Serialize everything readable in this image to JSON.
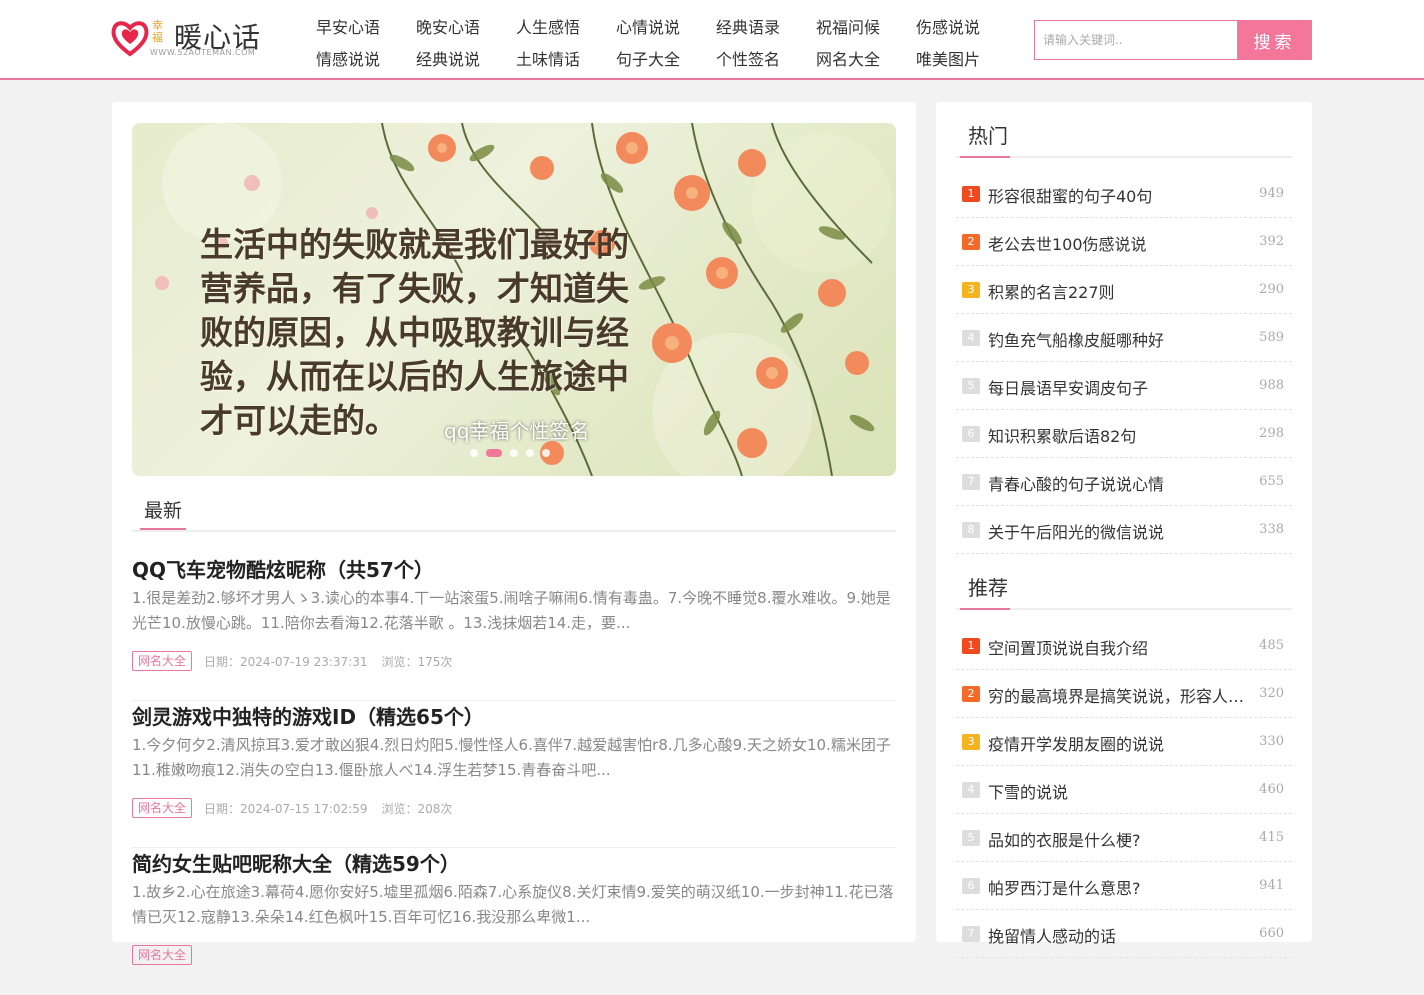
{
  "header": {
    "logo": {
      "text": "暖心话",
      "sub": "幸福",
      "url": "WWW.52AOTEMAN.COM"
    },
    "nav": [
      [
        "早安心语",
        "晚安心语",
        "人生感悟",
        "心情说说",
        "经典语录",
        "祝福问候",
        "伤感说说"
      ],
      [
        "情感说说",
        "经典说说",
        "土味情话",
        "句子大全",
        "个性签名",
        "网名大全",
        "唯美图片"
      ]
    ],
    "search": {
      "placeholder": "请输入关键词..",
      "button": "搜索"
    }
  },
  "banner": {
    "text": "生活中的失败就是我们最好的营养品，有了失败，才知道失败的原因，从中吸取教训与经验，从而在以后的人生旅途中才可以走的。",
    "caption": "qq幸福个性签名",
    "dots": 5,
    "active_dot": 2
  },
  "latest": {
    "title": "最新",
    "articles": [
      {
        "title": "QQ飞车宠物酷炫昵称（共57个）",
        "excerpt": "1.很是差劲2.够坏才男人ゝ3.读心的本事4.丅一站滚蛋5.闹啥子嘛闹6.情有毒蛊。7.今晚不睡觉8.覆水难收。9.她是光芒10.放慢心跳。11.陪你去看海12.花落半歌 。13.浅抹烟若14.走，要...",
        "tag": "网名大全",
        "date": "日期：2024-07-19 23:37:31",
        "views": "浏览：175次"
      },
      {
        "title": "剑灵游戏中独特的游戏ID（精选65个）",
        "excerpt": "1.今夕何夕2.清风掠耳3.爱才敢凶狠4.烈日灼阳5.慢性怪人6.喜伴7.越爱越害怕r8.几多心酸9.天之娇女10.糯米团子11.稚嫩吻痕12.消失の空白13.偃卧旅人べ14.浮生若梦15.青春奋斗吧...",
        "tag": "网名大全",
        "date": "日期：2024-07-15 17:02:59",
        "views": "浏览：208次"
      },
      {
        "title": "简约女生贴吧昵称大全（精选59个）",
        "excerpt": "1.故乡2.心在旅途3.幕荷4.愿你安好5.墟里孤烟6.陌森7.心系旋仪8.关灯束情9.爱笑的萌汉纸10.一步封神11.花已落情已灭12.寇静13.朵朵14.红色枫叶15.百年可忆16.我没那么卑微1...",
        "tag": "网名大全",
        "date": "",
        "views": ""
      }
    ]
  },
  "sidebar": {
    "hot": {
      "title": "热门",
      "items": [
        {
          "rank": "1",
          "text": "形容很甜蜜的句子40句",
          "count": "949"
        },
        {
          "rank": "2",
          "text": "老公去世100伤感说说",
          "count": "392"
        },
        {
          "rank": "3",
          "text": "积累的名言227则",
          "count": "290"
        },
        {
          "rank": "4",
          "text": "钓鱼充气船橡皮艇哪种好",
          "count": "589"
        },
        {
          "rank": "5",
          "text": "每日晨语早安调皮句子",
          "count": "988"
        },
        {
          "rank": "6",
          "text": "知识积累歇后语82句",
          "count": "298"
        },
        {
          "rank": "7",
          "text": "青春心酸的句子说说心情",
          "count": "655"
        },
        {
          "rank": "8",
          "text": "关于午后阳光的微信说说",
          "count": "338"
        }
      ]
    },
    "recommend": {
      "title": "推荐",
      "items": [
        {
          "rank": "1",
          "text": "空间置顶说说自我介绍",
          "count": "485"
        },
        {
          "rank": "2",
          "text": "穷的最高境界是搞笑说说，形容人穷的搞笑句子",
          "count": "320"
        },
        {
          "rank": "3",
          "text": "疫情开学发朋友圈的说说",
          "count": "330"
        },
        {
          "rank": "4",
          "text": "下雪的说说",
          "count": "460"
        },
        {
          "rank": "5",
          "text": "品如的衣服是什么梗?",
          "count": "415"
        },
        {
          "rank": "6",
          "text": "帕罗西汀是什么意思?",
          "count": "941"
        },
        {
          "rank": "7",
          "text": "挽留情人感动的话",
          "count": "660"
        }
      ]
    }
  },
  "colors": {
    "accent": "#e8779b",
    "rank1": "#f04a1e",
    "rank2": "#f56a28",
    "rank3": "#f5b41e"
  }
}
